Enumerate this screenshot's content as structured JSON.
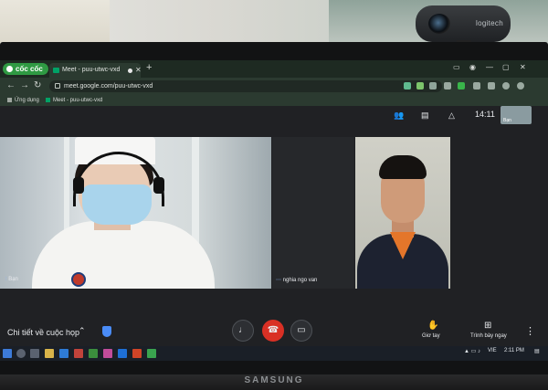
{
  "webcam": {
    "brand": "logitech"
  },
  "monitor": {
    "brand": "SAMSUNG"
  },
  "browser": {
    "logo_label": "cốc cốc",
    "tab_title": "Meet - puu-utwc-vxd",
    "new_tab": "+",
    "url": "meet.google.com/puu-utwc-vxd",
    "bookmarks": [
      "Ứng dụng",
      "Meet - puu-utwc-vxd"
    ]
  },
  "meet": {
    "clock": "14:11",
    "self_thumb_label": "Bạn",
    "participants": [
      {
        "name": "Bạn"
      },
      {
        "name": "nghia ngo van"
      }
    ],
    "bottom": {
      "details_label": "Chi tiết về cuộc họp",
      "raise_hand_label": "Giơ tay",
      "present_label": "Trình bày ngay"
    }
  },
  "taskbar": {
    "lang": "VIE",
    "time": "2:11 PM"
  }
}
